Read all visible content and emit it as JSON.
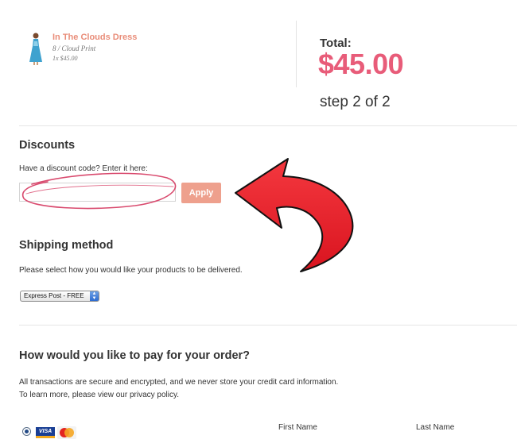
{
  "order": {
    "product_name": "In The Clouds Dress",
    "variant": "8 / Cloud Print",
    "qty_price": "1x $45.00"
  },
  "summary": {
    "total_label": "Total:",
    "total_amount": "$45.00",
    "step": "step 2 of 2"
  },
  "discounts": {
    "heading": "Discounts",
    "prompt": "Have a discount code? Enter it here:",
    "input_value": "",
    "apply_label": "Apply"
  },
  "shipping": {
    "heading": "Shipping method",
    "description": "Please select how you would like your products to be delivered.",
    "selected_option": "Express Post - FREE"
  },
  "payment": {
    "heading": "How would you like to pay for your order?",
    "security_note": "All transactions are secure and encrypted, and we never store your credit card information.",
    "privacy_note": "To learn more, please view our privacy policy.",
    "visa_label": "VISA",
    "first_name_label": "First Name",
    "last_name_label": "Last Name"
  },
  "colors": {
    "accent_total": "#e85c79",
    "product_link": "#e98d79",
    "apply_button": "#eea08d",
    "annotation_arrow": "#e8202f",
    "annotation_circle": "#d94a6e"
  }
}
